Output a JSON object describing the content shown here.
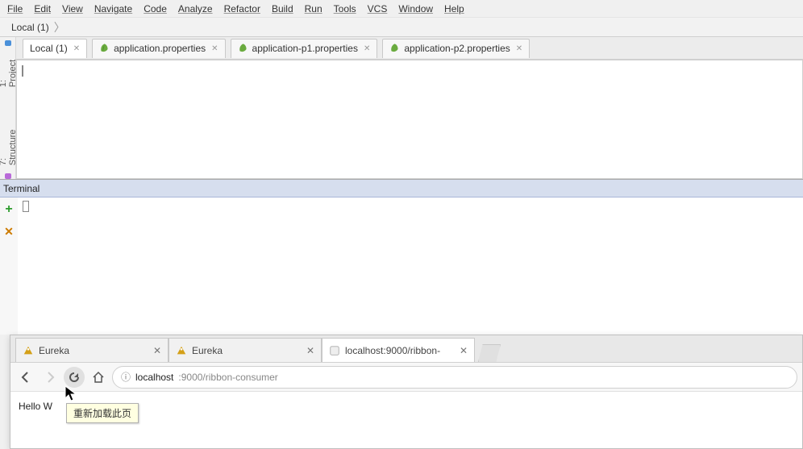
{
  "ide": {
    "menu": [
      "File",
      "Edit",
      "View",
      "Navigate",
      "Code",
      "Analyze",
      "Refactor",
      "Build",
      "Run",
      "Tools",
      "VCS",
      "Window",
      "Help"
    ],
    "breadcrumb": "Local (1)",
    "side_tools": {
      "project": "1: Project",
      "structure": "7: Structure"
    },
    "editor_tabs": [
      {
        "label": "Local (1)",
        "has_icon": false
      },
      {
        "label": "application.properties",
        "has_icon": true
      },
      {
        "label": "application-p1.properties",
        "has_icon": true
      },
      {
        "label": "application-p2.properties",
        "has_icon": true
      }
    ],
    "terminal": {
      "title": "Terminal"
    }
  },
  "browser": {
    "tabs": [
      {
        "title": "Eureka",
        "active": false
      },
      {
        "title": "Eureka",
        "active": false
      },
      {
        "title": "localhost:9000/ribbon-",
        "active": true
      }
    ],
    "address": {
      "host": "localhost",
      "port_path": ":9000/ribbon-consumer"
    },
    "reload_tooltip": "重新加载此页",
    "page_text": "Hello W"
  }
}
